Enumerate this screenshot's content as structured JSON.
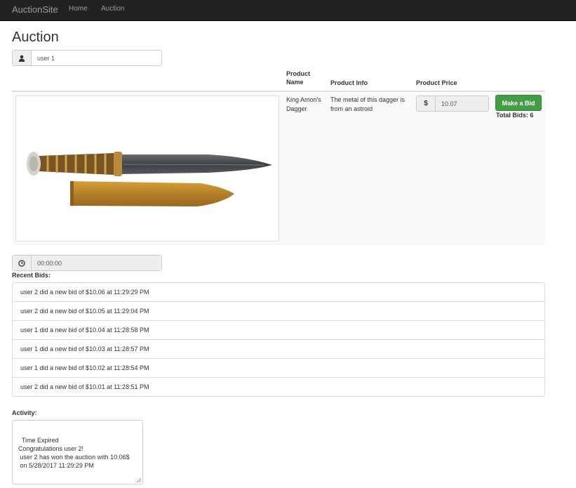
{
  "navbar": {
    "brand": "AuctionSite",
    "links": [
      "Home",
      "Auction"
    ]
  },
  "page_title": "Auction",
  "user_field": {
    "value": "user 1",
    "icon": "user-icon"
  },
  "table": {
    "headers": {
      "name": "Product Name",
      "info": "Product Info",
      "price": "Product Price"
    },
    "row": {
      "name": "King Amon's Dagger",
      "info": "The metal of this dagger is from an astroid",
      "currency_symbol": "$",
      "price": "10.07",
      "bid_button": "Make a Bid",
      "total_bids": "Total Bids: 6",
      "image": "dagger-with-golden-sheath"
    }
  },
  "timer": {
    "value": "00:00:00",
    "icon": "clock-icon"
  },
  "recent_bids_label": "Recent Bids:",
  "recent_bids": [
    "user 2 did a new bid of $10.06 at 11:29:29 PM",
    "user 2 did a new bid of $10.05 at 11:29:04 PM",
    "user 1 did a new bid of $10.04 at 11:28:58 PM",
    "user 1 did a new bid of $10.03 at 11:28:57 PM",
    "user 1 did a new bid of $10.02 at 11:28:54 PM",
    "user 2 did a new bid of $10.01 at 11:28:51 PM"
  ],
  "activity_label": "Activity:",
  "activity_text": "Time Expired\nCongratulations user 2!\n user 2 has won the auction with 10.06$\n on 5/28/2017 11:29:29 PM",
  "colors": {
    "navbar": "#222222",
    "bid_button": "#449d44",
    "row_background": "#f9f9f9"
  }
}
